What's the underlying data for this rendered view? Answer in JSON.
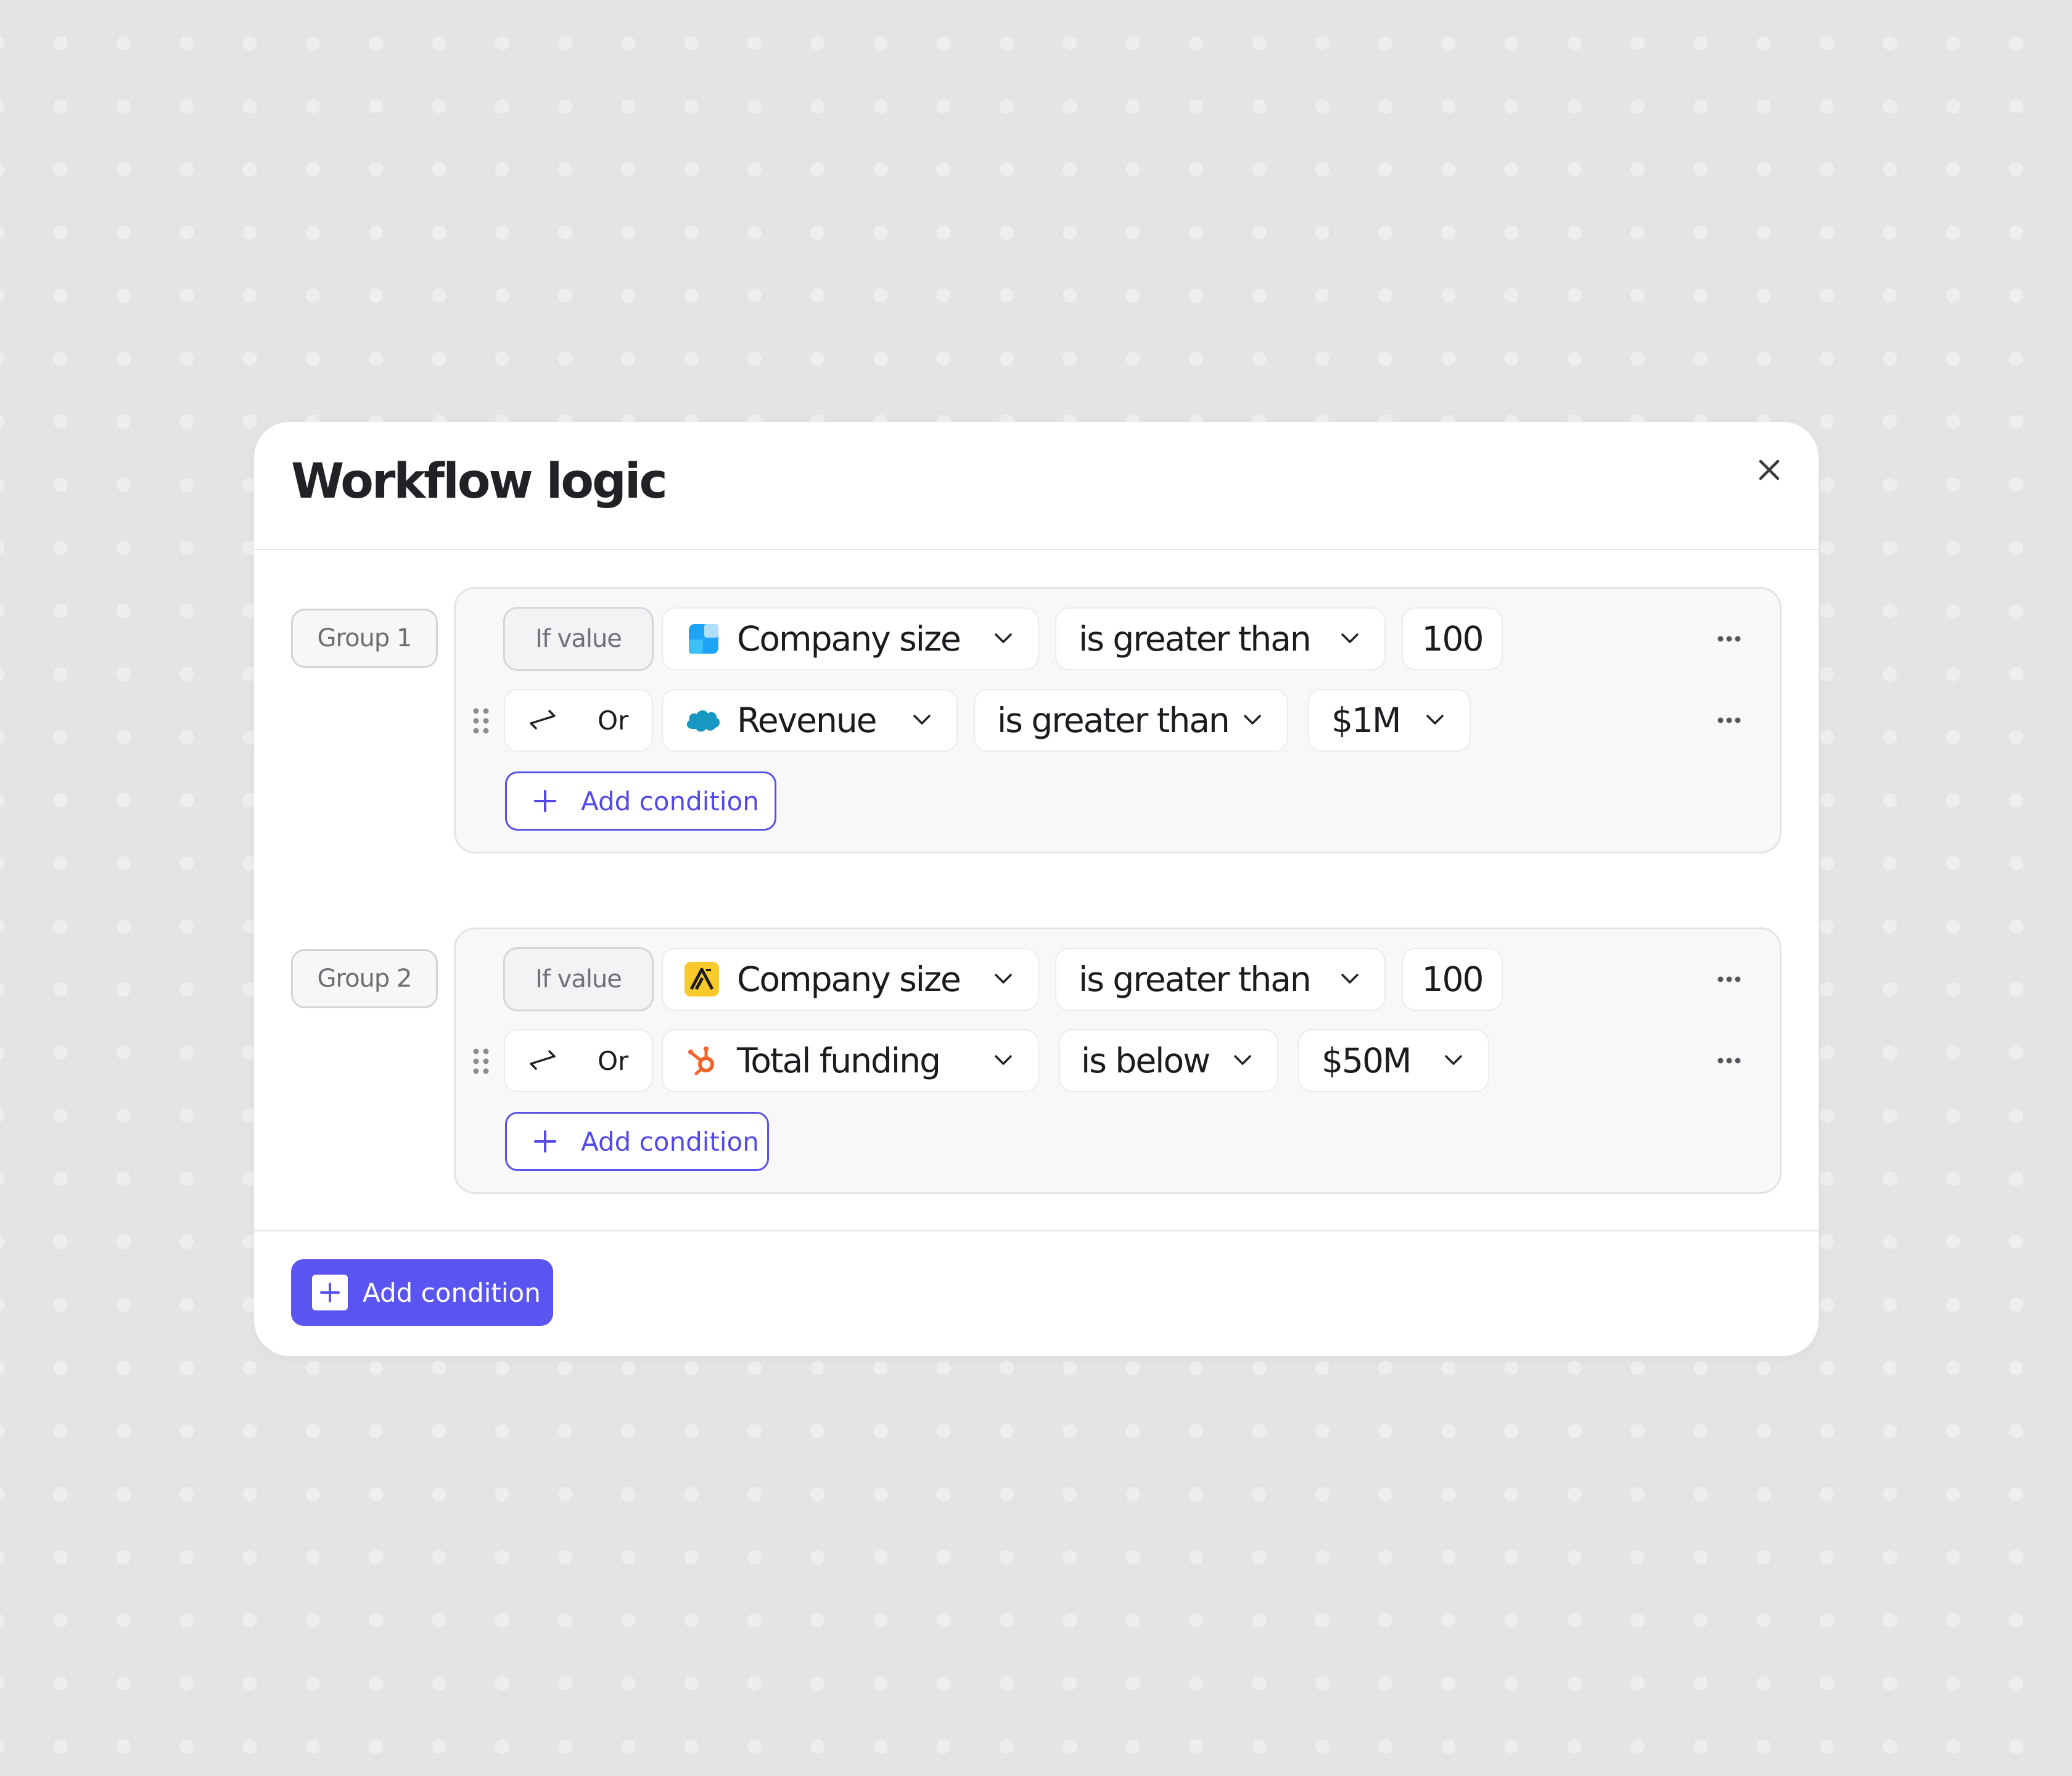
{
  "modal": {
    "title": "Workflow logic",
    "close_icon": "close-icon"
  },
  "groups": [
    {
      "label": "Group 1",
      "rows": [
        {
          "connector": "If value",
          "field": "Company size",
          "field_icon": "company-blue-icon",
          "operator": "is greater than",
          "value": "100",
          "value_has_dropdown": false
        },
        {
          "connector": "Or",
          "field": "Revenue",
          "field_icon": "salesforce-icon",
          "operator": "is greater than",
          "value": "$1M",
          "value_has_dropdown": true
        }
      ],
      "add_label": "Add condition"
    },
    {
      "label": "Group 2",
      "rows": [
        {
          "connector": "If value",
          "field": "Company size",
          "field_icon": "apollo-icon",
          "operator": "is greater than",
          "value": "100",
          "value_has_dropdown": false
        },
        {
          "connector": "Or",
          "field": "Total funding",
          "field_icon": "hubspot-icon",
          "operator": "is below",
          "value": "$50M",
          "value_has_dropdown": true
        }
      ],
      "add_label": "Add condition"
    }
  ],
  "footer": {
    "add_label": "Add condition"
  },
  "colors": {
    "accent": "#5a55f0",
    "accent_text": "#5349e6",
    "background": "#e4e4e7"
  }
}
